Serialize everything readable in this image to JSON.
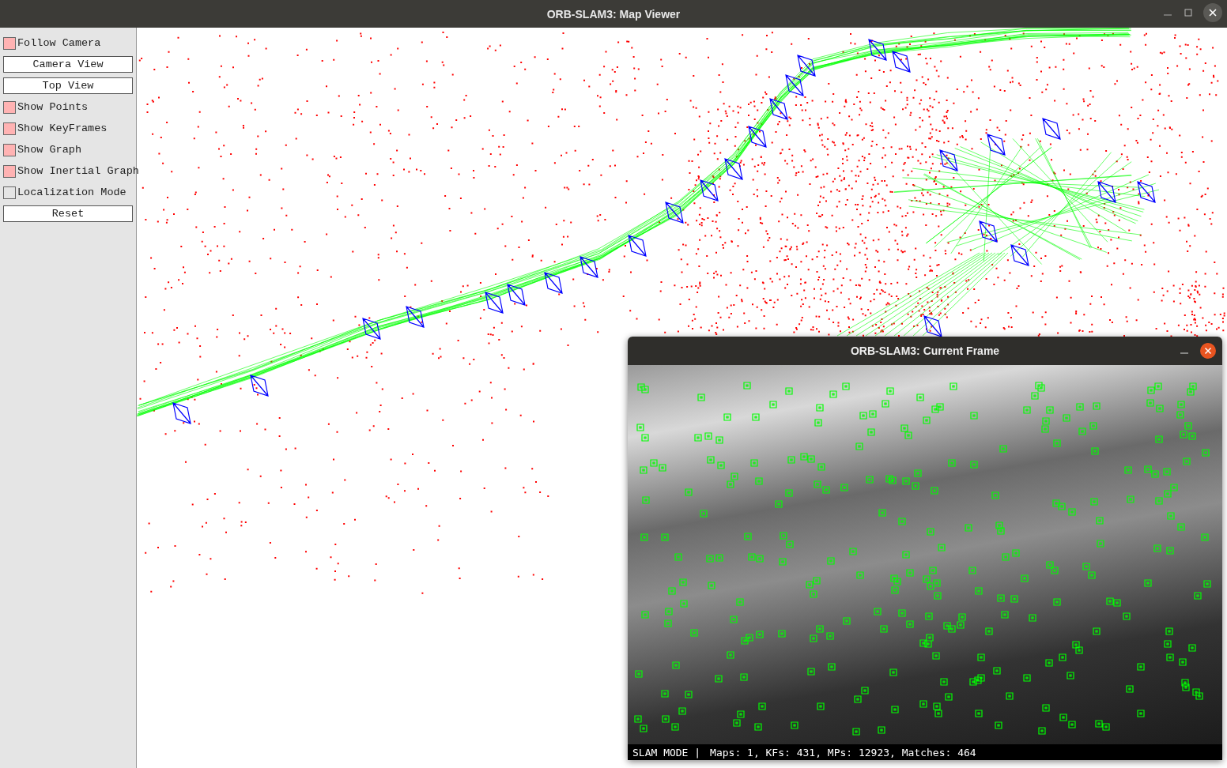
{
  "window": {
    "title": "ORB-SLAM3: Map Viewer"
  },
  "panel": {
    "items": [
      {
        "kind": "checkbox",
        "label": "Follow Camera",
        "checked": true
      },
      {
        "kind": "button",
        "label": "Camera View"
      },
      {
        "kind": "button",
        "label": "Top View"
      },
      {
        "kind": "checkbox",
        "label": "Show Points",
        "checked": true
      },
      {
        "kind": "checkbox",
        "label": "Show KeyFrames",
        "checked": true
      },
      {
        "kind": "checkbox",
        "label": "Show Graph",
        "checked": true
      },
      {
        "kind": "checkbox",
        "label": "Show Inertial Graph",
        "checked": true
      },
      {
        "kind": "checkbox",
        "label": "Localization Mode",
        "checked": false
      },
      {
        "kind": "button",
        "label": "Reset"
      }
    ]
  },
  "frame_window": {
    "title": "ORB-SLAM3: Current Frame",
    "mode": "SLAM MODE |",
    "stats": "Maps: 1, KFs: 431, MPs: 12923, Matches: 464"
  }
}
